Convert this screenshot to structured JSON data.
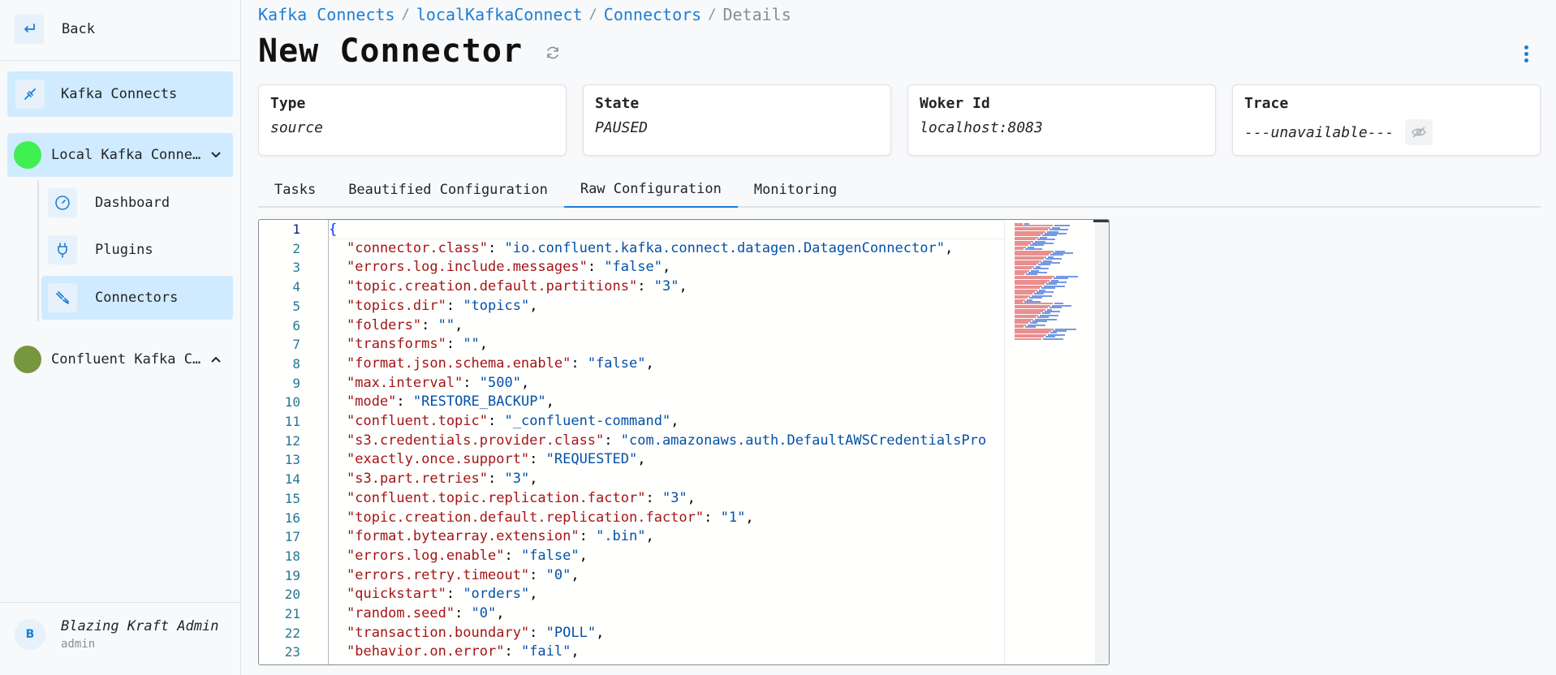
{
  "sidebar": {
    "back_label": "Back",
    "kafka_connects_label": "Kafka Connects",
    "clusters": [
      {
        "label": "Local Kafka Conne…",
        "color": "#40f050",
        "expanded": true
      },
      {
        "label": "Confluent Kafka C…",
        "color": "#77973f",
        "expanded": false
      }
    ],
    "sub_items": [
      {
        "label": "Dashboard",
        "icon": "gauge-icon"
      },
      {
        "label": "Plugins",
        "icon": "plug-icon"
      },
      {
        "label": "Connectors",
        "icon": "connector-icon"
      }
    ],
    "user": {
      "initial": "B",
      "name": "Blazing Kraft Admin",
      "role": "admin"
    }
  },
  "breadcrumb": {
    "items": [
      "Kafka Connects",
      "localKafkaConnect",
      "Connectors"
    ],
    "current": "Details",
    "separator": "/"
  },
  "page": {
    "title": "New Connector"
  },
  "cards": [
    {
      "title": "Type",
      "value": "source"
    },
    {
      "title": "State",
      "value": "PAUSED"
    },
    {
      "title": "Woker Id",
      "value": "localhost:8083"
    },
    {
      "title": "Trace",
      "value": "---unavailable---"
    }
  ],
  "tabs": [
    "Tasks",
    "Beautified Configuration",
    "Raw Configuration",
    "Monitoring"
  ],
  "active_tab": "Raw Configuration",
  "editor": {
    "open_brace": "{",
    "lines": [
      {
        "n": "1",
        "key": "",
        "value": ""
      },
      {
        "n": "2",
        "key": "\"connector.class\"",
        "value": "\"io.confluent.kafka.connect.datagen.DatagenConnector\""
      },
      {
        "n": "3",
        "key": "\"errors.log.include.messages\"",
        "value": "\"false\""
      },
      {
        "n": "4",
        "key": "\"topic.creation.default.partitions\"",
        "value": "\"3\""
      },
      {
        "n": "5",
        "key": "\"topics.dir\"",
        "value": "\"topics\""
      },
      {
        "n": "6",
        "key": "\"folders\"",
        "value": "\"\""
      },
      {
        "n": "7",
        "key": "\"transforms\"",
        "value": "\"\""
      },
      {
        "n": "8",
        "key": "\"format.json.schema.enable\"",
        "value": "\"false\""
      },
      {
        "n": "9",
        "key": "\"max.interval\"",
        "value": "\"500\""
      },
      {
        "n": "10",
        "key": "\"mode\"",
        "value": "\"RESTORE_BACKUP\""
      },
      {
        "n": "11",
        "key": "\"confluent.topic\"",
        "value": "\"_confluent-command\""
      },
      {
        "n": "12",
        "key": "\"s3.credentials.provider.class\"",
        "value": "\"com.amazonaws.auth.DefaultAWSCredentialsPro"
      },
      {
        "n": "13",
        "key": "\"exactly.once.support\"",
        "value": "\"REQUESTED\""
      },
      {
        "n": "14",
        "key": "\"s3.part.retries\"",
        "value": "\"3\""
      },
      {
        "n": "15",
        "key": "\"confluent.topic.replication.factor\"",
        "value": "\"3\""
      },
      {
        "n": "16",
        "key": "\"topic.creation.default.replication.factor\"",
        "value": "\"1\""
      },
      {
        "n": "17",
        "key": "\"format.bytearray.extension\"",
        "value": "\".bin\""
      },
      {
        "n": "18",
        "key": "\"errors.log.enable\"",
        "value": "\"false\""
      },
      {
        "n": "19",
        "key": "\"errors.retry.timeout\"",
        "value": "\"0\""
      },
      {
        "n": "20",
        "key": "\"quickstart\"",
        "value": "\"orders\""
      },
      {
        "n": "21",
        "key": "\"random.seed\"",
        "value": "\"0\""
      },
      {
        "n": "22",
        "key": "\"transaction.boundary\"",
        "value": "\"POLL\""
      },
      {
        "n": "23",
        "key": "\"behavior.on.error\"",
        "value": "\"fail\""
      }
    ]
  },
  "colors": {
    "accent": "#1c7ed6",
    "active_bg": "#d0ebff",
    "json_key": "#a31515",
    "json_value": "#0451a5"
  }
}
